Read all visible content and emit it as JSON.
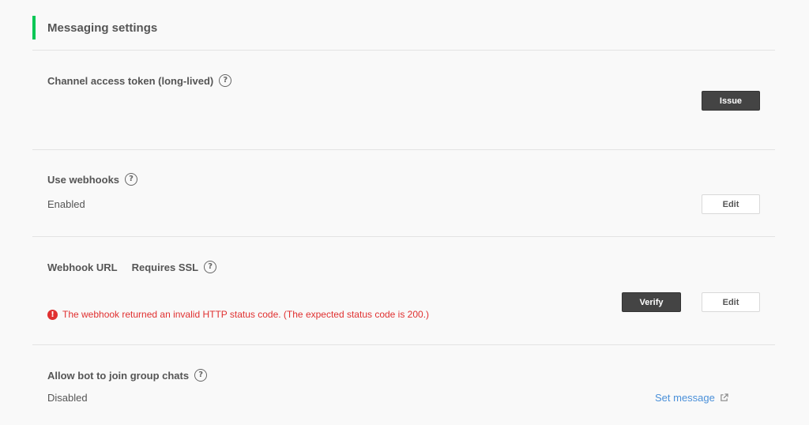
{
  "page": {
    "title": "Messaging settings",
    "accent_color": "#06c755"
  },
  "access_token": {
    "label": "Channel access token (long-lived)",
    "help_icon": "?",
    "issue_button": "Issue"
  },
  "webhooks": {
    "label": "Use webhooks",
    "help_icon": "?",
    "status": "Enabled",
    "edit_button": "Edit"
  },
  "webhook_url": {
    "label": "Webhook URL",
    "ssl_label": "Requires SSL",
    "help_icon": "?",
    "verify_button": "Verify",
    "edit_button": "Edit",
    "error_icon": "!",
    "error_message": "The webhook returned an invalid HTTP status code. (The expected status code is 200.)",
    "error_color": "#e03030"
  },
  "group_chats": {
    "label": "Allow bot to join group chats",
    "help_icon": "?",
    "status": "Disabled",
    "link_label": "Set message",
    "link_color": "#4a90d9"
  }
}
